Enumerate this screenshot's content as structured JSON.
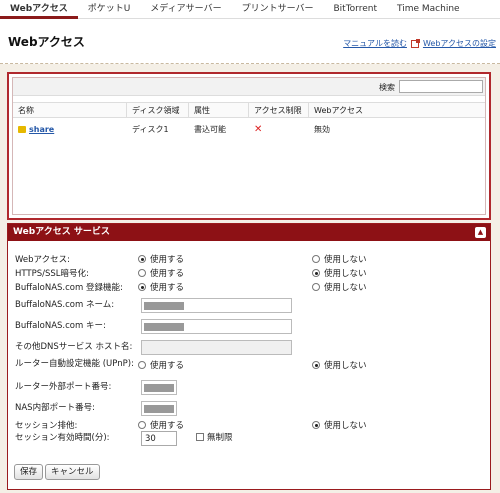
{
  "nav": {
    "tabs": [
      "Webアクセス",
      "ポケットU",
      "メディアサーバー",
      "プリントサーバー",
      "BitTorrent",
      "Time Machine"
    ]
  },
  "header": {
    "title": "Webアクセス",
    "manual_link": "マニュアルを読む",
    "settings_link": "Webアクセスの設定"
  },
  "share_list": {
    "search_label": "検索",
    "search_value": "",
    "columns": [
      "名称",
      "ディスク領域",
      "属性",
      "アクセス制限",
      "Webアクセス"
    ],
    "rows": [
      {
        "name": "share",
        "disk": "ディスク1",
        "attribute": "書込可能",
        "access_restriction": "✕",
        "web_access": "無効"
      }
    ]
  },
  "settings": {
    "title": "Webアクセス サービス",
    "opt_use": "使用する",
    "opt_nouse": "使用しない",
    "web_access": {
      "label": "Webアクセス:",
      "selected": "使用する"
    },
    "https": {
      "label": "HTTPS/SSL暗号化:",
      "selected": "使用しない"
    },
    "buffalonas_reg": {
      "label": "BuffaloNAS.com 登録機能:",
      "selected": "使用する"
    },
    "buffalonas_name": {
      "label": "BuffaloNAS.com ネーム:"
    },
    "buffalonas_key": {
      "label": "BuffaloNAS.com キー:"
    },
    "dns_host": {
      "label": "その他DNSサービス ホスト名:"
    },
    "upnp": {
      "label": "ルーター自動設定機能 (UPnP):",
      "selected": "使用しない"
    },
    "router_port": {
      "label": "ルーター外部ポート番号:"
    },
    "nas_port": {
      "label": "NAS内部ポート番号:"
    },
    "session_exclusive": {
      "label": "セッション排他:",
      "selected": "使用しない"
    },
    "session_timeout": {
      "label": "セッション有効時間(分):",
      "value": "30",
      "unlimited_label": "無制限",
      "unlimited_checked": false
    },
    "save_label": "保存",
    "cancel_label": "キャンセル"
  }
}
